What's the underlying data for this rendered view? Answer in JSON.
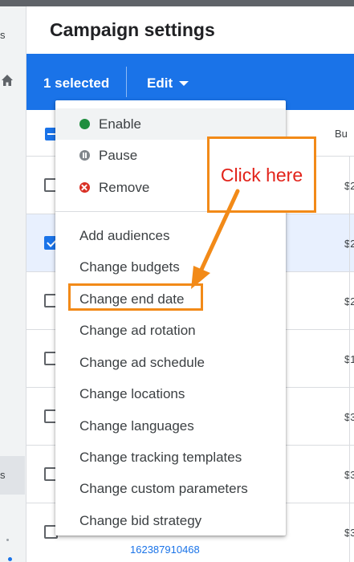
{
  "sidebar": {
    "top_fragment": "s",
    "selected_fragment": "s"
  },
  "header": {
    "title": "Campaign settings"
  },
  "action_bar": {
    "selected_count": "1 selected",
    "edit_label": "Edit"
  },
  "table": {
    "budget_header_fragment": "Bu",
    "budget_fragments": [
      "$2",
      "$2",
      "$2",
      "$1",
      "$3",
      "$3",
      "$3"
    ],
    "id_fragment": "162387910468"
  },
  "edit_menu": {
    "status_items": [
      {
        "label": "Enable",
        "icon": "green-dot-icon"
      },
      {
        "label": "Pause",
        "icon": "pause-icon"
      },
      {
        "label": "Remove",
        "icon": "remove-icon"
      }
    ],
    "items": [
      "Add audiences",
      "Change budgets",
      "Change end date",
      "Change ad rotation",
      "Change ad schedule",
      "Change locations",
      "Change languages",
      "Change tracking templates",
      "Change custom parameters",
      "Change bid strategy"
    ]
  },
  "annotation": {
    "callout_text": "Click here",
    "accent_color": "#f28a18",
    "text_color": "#e2231a"
  },
  "colors": {
    "brand_blue": "#1a73e8",
    "enable_green": "#1e8e3e",
    "remove_red": "#d93025"
  }
}
